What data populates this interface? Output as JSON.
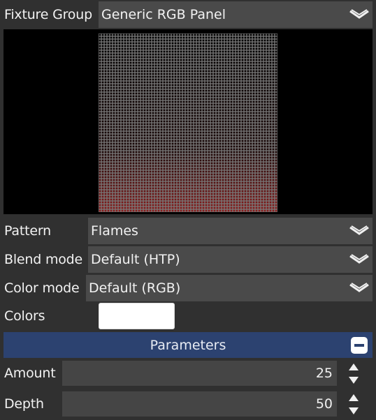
{
  "fixture_group": {
    "label": "Fixture Group",
    "value": "Generic RGB Panel"
  },
  "preview": {
    "cols": 64,
    "rows": 64,
    "glow_color": "#8a1c1c",
    "base_color": "#7a7a7a"
  },
  "pattern": {
    "label": "Pattern",
    "value": "Flames"
  },
  "blend_mode": {
    "label": "Blend mode",
    "value": "Default (HTP)"
  },
  "color_mode": {
    "label": "Color mode",
    "value": "Default (RGB)"
  },
  "colors": {
    "label": "Colors",
    "swatch": "#ffffff"
  },
  "parameters": {
    "title": "Parameters",
    "items": [
      {
        "label": "Amount",
        "value": "25"
      },
      {
        "label": "Depth",
        "value": "50"
      }
    ]
  }
}
